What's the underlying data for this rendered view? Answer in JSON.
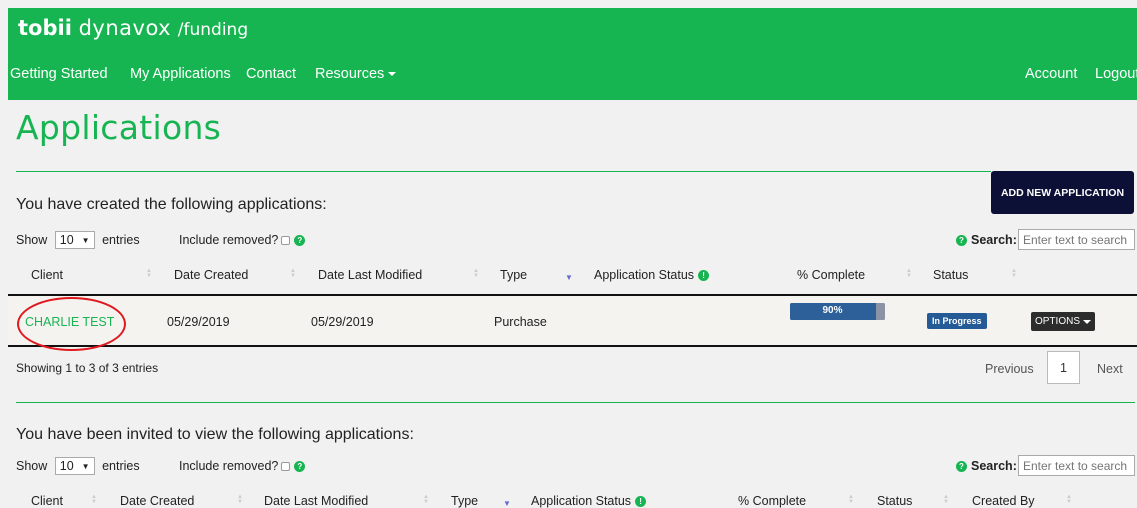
{
  "header": {
    "brand_bold": "tobii",
    "brand_regular": "dynavox",
    "brand_suffix": "/funding",
    "nav": [
      {
        "label": "Getting Started"
      },
      {
        "label": "My Applications"
      },
      {
        "label": "Contact"
      },
      {
        "label": "Resources"
      }
    ],
    "right_nav": [
      {
        "label": "Account"
      },
      {
        "label": "Logout"
      }
    ],
    "color": "#17b552"
  },
  "page_title": "Applications",
  "add_button": "ADD NEW APPLICATION",
  "created_section": {
    "title": "You have created the following applications:",
    "show_label": "Show",
    "entries_value": "10",
    "entries_label": "entries",
    "include_removed": "Include removed?",
    "search_label": "Search:",
    "search_placeholder": "Enter text to search",
    "columns": [
      "Client",
      "Date Created",
      "Date Last Modified",
      "Type",
      "Application Status",
      "% Complete",
      "Status"
    ],
    "rows": [
      {
        "client": "CHARLIE TEST",
        "date_created": "05/29/2019",
        "date_modified": "05/29/2019",
        "type": "Purchase",
        "percent_complete": 90,
        "percent_label": "90%",
        "status": "In Progress",
        "options": "OPTIONS"
      }
    ],
    "info": "Showing 1 to 3 of 3 entries",
    "pager": {
      "previous": "Previous",
      "page": "1",
      "next": "Next"
    }
  },
  "invited_section": {
    "title": "You have been invited to view the following applications:",
    "show_label": "Show",
    "entries_value": "10",
    "entries_label": "entries",
    "include_removed": "Include removed?",
    "search_label": "Search:",
    "search_placeholder": "Enter text to search",
    "columns": [
      "Client",
      "Date Created",
      "Date Last Modified",
      "Type",
      "Application Status",
      "% Complete",
      "Status",
      "Created By"
    ]
  }
}
